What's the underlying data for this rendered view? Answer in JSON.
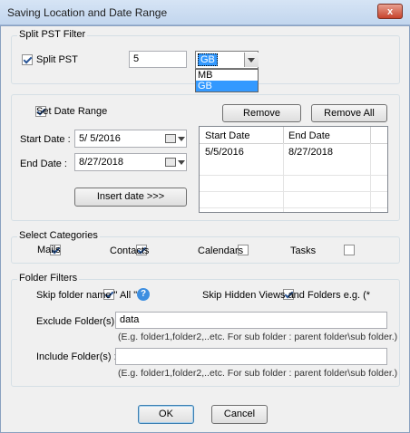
{
  "window": {
    "title": "Saving Location and Date Range",
    "close_label": "x"
  },
  "split_pst": {
    "group_label": "Split PST Filter",
    "checkbox_label": "Split PST",
    "checked": true,
    "size_value": "5",
    "unit_selected": "GB",
    "unit_options": [
      "MB",
      "GB"
    ]
  },
  "date_range": {
    "checkbox_label": "Set Date Range",
    "checked": true,
    "remove_label": "Remove",
    "remove_all_label": "Remove All",
    "start_label": "Start Date :",
    "start_value": "5/ 5/2016",
    "end_label": "End Date :",
    "end_value": "8/27/2018",
    "insert_label": "Insert date >>>",
    "table": {
      "headers": [
        "Start Date",
        "End Date"
      ],
      "rows": [
        [
          "5/5/2016",
          "8/27/2018"
        ]
      ]
    }
  },
  "categories": {
    "group_label": "Select Categories",
    "items": [
      {
        "label": "Mails",
        "checked": true
      },
      {
        "label": "Contacts",
        "checked": true
      },
      {
        "label": "Calendars",
        "checked": false
      },
      {
        "label": "Tasks",
        "checked": false
      }
    ]
  },
  "folder_filters": {
    "group_label": "Folder Filters",
    "skip_all_label": "Skip folder name \" All \"",
    "skip_all_checked": true,
    "skip_hidden_label": "Skip Hidden Views and Folders e.g. (*",
    "skip_hidden_checked": true,
    "exclude_label": "Exclude Folder(s) :",
    "exclude_selected": true,
    "exclude_value": "data",
    "exclude_hint": "(E.g. folder1,folder2,..etc. For sub folder : parent folder\\sub folder.)",
    "include_label": "Include Folder(s) :",
    "include_selected": false,
    "include_value": "",
    "include_hint": "(E.g. folder1,folder2,..etc. For sub folder : parent folder\\sub folder.)"
  },
  "footer": {
    "ok_label": "OK",
    "cancel_label": "Cancel"
  }
}
